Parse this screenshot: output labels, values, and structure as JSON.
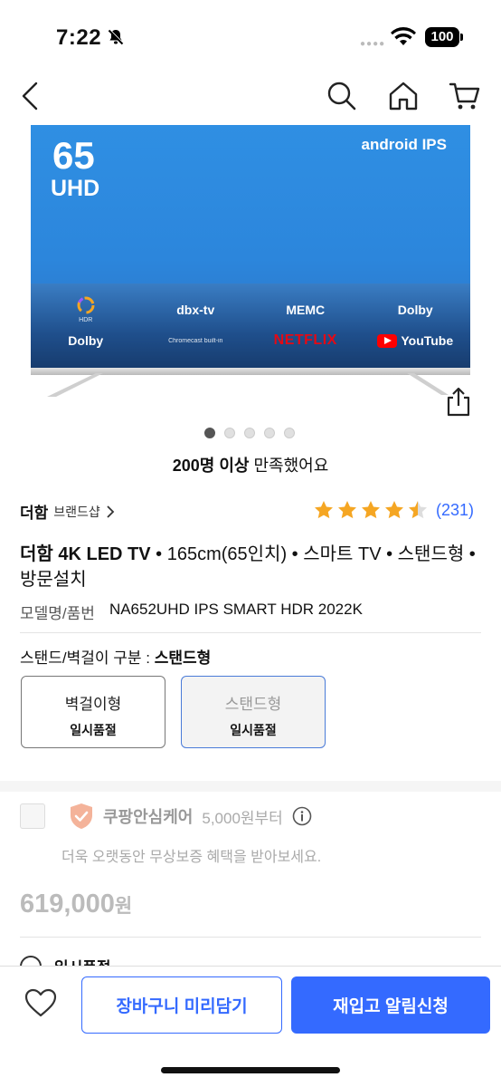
{
  "status_bar": {
    "time": "7:22",
    "battery": "100"
  },
  "product_image": {
    "screen_size": "65",
    "resolution": "UHD",
    "brand_text": "android IPS",
    "features_row1": [
      "HDR",
      "dbx-tv",
      "MEMC",
      "Dolby"
    ],
    "features_row2": [
      "Dolby",
      "Chromecast built-in",
      "NETFLIX",
      "YouTube"
    ],
    "carousel_count": 5,
    "carousel_active": 0
  },
  "satisfaction": {
    "strong": "200명 이상",
    "rest": " 만족했어요"
  },
  "brand": {
    "name": "더함",
    "shop": "브랜드샵"
  },
  "rating": {
    "stars": 4.5,
    "count": "(231)",
    "color": "#f5a623"
  },
  "title": {
    "strong": "더함 4K LED TV",
    "rest": " • 165cm(65인치) • 스마트 TV • 스탠드형 • 방문설치"
  },
  "model": {
    "label": "모델명/품번",
    "value": "NA652UHD IPS SMART HDR 2022K"
  },
  "option": {
    "label": "스탠드/벽걸이 구분 : ",
    "selected": "스탠드형",
    "choices": [
      {
        "name": "벽걸이형",
        "status": "일시품절"
      },
      {
        "name": "스탠드형",
        "status": "일시품절"
      }
    ]
  },
  "care": {
    "title": "쿠팡안심케어",
    "price": "5,000원부터",
    "description": "더욱 오랫동안 무상보증 혜택을 받아보세요."
  },
  "price": {
    "amount": "619,000",
    "unit": "원"
  },
  "stock_peek": "일시품절",
  "bottom": {
    "cart_label": "장바구니 미리담기",
    "alert_label": "재입고 알림신청"
  },
  "colors": {
    "accent": "#346aff",
    "star": "#f5a623"
  }
}
